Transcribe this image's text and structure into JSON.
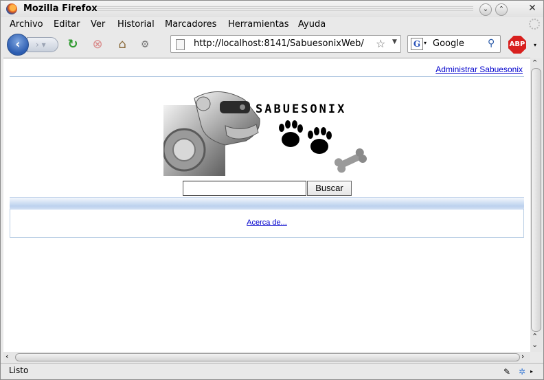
{
  "window": {
    "title": "Mozilla Firefox"
  },
  "menu": [
    {
      "label": "Archivo"
    },
    {
      "label": "Editar"
    },
    {
      "label": "Ver"
    },
    {
      "label": "Historial"
    },
    {
      "label": "Marcadores"
    },
    {
      "label": "Herramientas"
    },
    {
      "label": "Ayuda"
    }
  ],
  "navbar": {
    "url": "http://localhost:8141/SabuesonixWeb/",
    "search_engine": "Google",
    "search_value": "Google",
    "abp_label": "ABP"
  },
  "page": {
    "admin_link": "Administrar Sabuesonix",
    "logo_text": "SABUESONIX",
    "search_input_value": "",
    "search_button": "Buscar",
    "about_link": "Acerca de..."
  },
  "status": {
    "text": "Listo"
  },
  "colors": {
    "link": "#0000cc",
    "bar": "#bcd1ee",
    "abp": "#d8201e"
  }
}
